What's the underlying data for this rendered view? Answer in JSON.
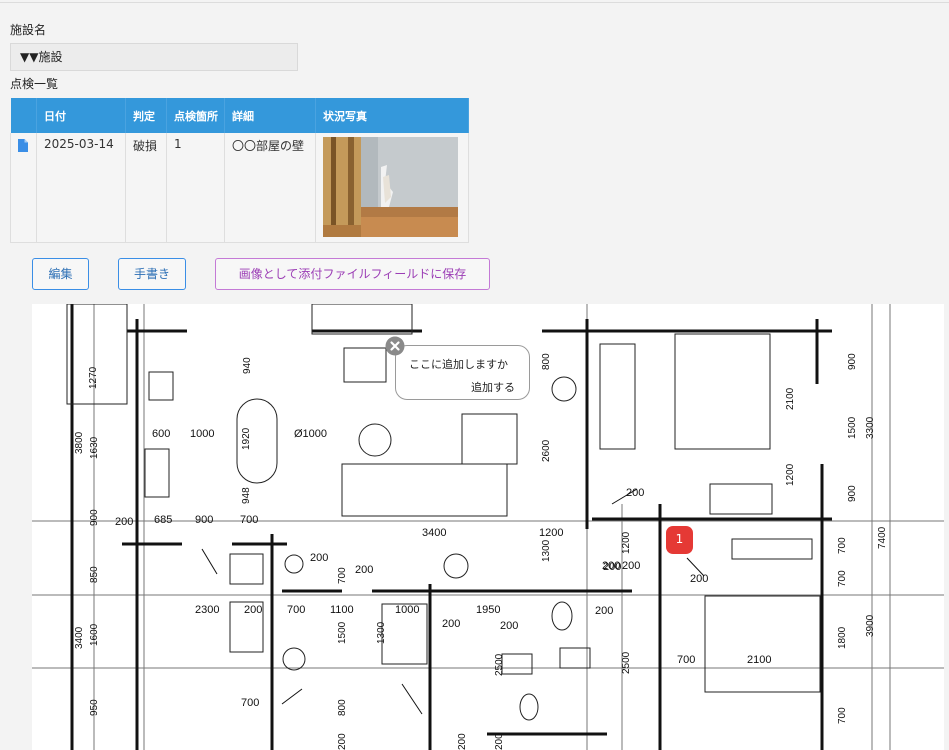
{
  "facility": {
    "label": "施設名",
    "value": "▼▼施設"
  },
  "inspection_list": {
    "label": "点検一覧",
    "columns": [
      "",
      "日付",
      "判定",
      "点検箇所",
      "詳細",
      "状況写真"
    ],
    "rows": [
      {
        "icon": "document-icon",
        "date": "2025-03-14",
        "judgement": "破損",
        "location": "1",
        "detail": "〇〇部屋の壁"
      }
    ]
  },
  "buttons": {
    "edit": "編集",
    "handwrite": "手書き",
    "save_as_image": "画像として添付ファイルフィールドに保存"
  },
  "popup": {
    "question": "ここに追加しますか",
    "action": "追加する"
  },
  "pin": {
    "number": "1"
  },
  "floorplan": {
    "dims": [
      "1270",
      "940",
      "800",
      "2100",
      "900",
      "3800",
      "1630",
      "600",
      "1000",
      "1920",
      "Ø1000",
      "2600",
      "1500",
      "3300",
      "200",
      "1200",
      "900",
      "948",
      "900",
      "200",
      "685",
      "900",
      "700",
      "3400",
      "1200",
      "1300",
      "1200",
      "7400",
      "200",
      "200",
      "700",
      "850",
      "200",
      "700",
      "200",
      "200",
      "200",
      "700",
      "2300",
      "200",
      "700",
      "1100",
      "1000",
      "1950",
      "3400",
      "1600",
      "1500",
      "1300",
      "200",
      "200",
      "2500",
      "2500",
      "1800",
      "3900",
      "700",
      "2100",
      "950",
      "700",
      "800",
      "200",
      "200",
      "700"
    ]
  },
  "colors": {
    "header_blue": "#3498db",
    "button_blue": "#3a8ee6",
    "button_purple": "#c47ad6",
    "pin_red": "#e53935"
  }
}
